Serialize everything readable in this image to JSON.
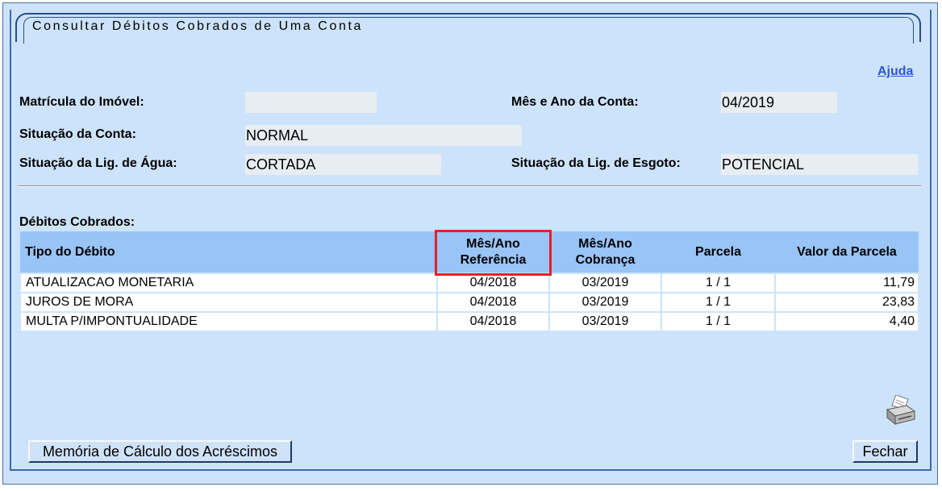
{
  "page": {
    "title": "Consultar Débitos Cobrados de Uma Conta",
    "help_label": "Ajuda"
  },
  "fields": {
    "matricula_label": "Matrícula do Imóvel:",
    "matricula_value": "",
    "mes_ano_label": "Mês e Ano da Conta:",
    "mes_ano_value": "04/2019",
    "situacao_conta_label": "Situação da Conta:",
    "situacao_conta_value": "NORMAL",
    "situacao_agua_label": "Situação da Lig. de Água:",
    "situacao_agua_value": "CORTADA",
    "situacao_esgoto_label": "Situação da Lig. de Esgoto:",
    "situacao_esgoto_value": "POTENCIAL"
  },
  "debts": {
    "section_title": "Débitos Cobrados:",
    "headers": {
      "tipo": "Tipo do Débito",
      "ref_line1": "Mês/Ano",
      "ref_line2": "Referência",
      "cob_line1": "Mês/Ano",
      "cob_line2": "Cobrança",
      "parcela": "Parcela",
      "valor": "Valor da Parcela"
    },
    "rows": [
      {
        "tipo": "ATUALIZACAO MONETARIA",
        "referencia": "04/2018",
        "cobranca": "03/2019",
        "parcela": "1 / 1",
        "valor": "11,79"
      },
      {
        "tipo": "JUROS DE MORA",
        "referencia": "04/2018",
        "cobranca": "03/2019",
        "parcela": "1 / 1",
        "valor": "23,83"
      },
      {
        "tipo": "MULTA P/IMPONTUALIDADE",
        "referencia": "04/2018",
        "cobranca": "03/2019",
        "parcela": "1 / 1",
        "valor": "4,40"
      }
    ]
  },
  "buttons": {
    "memoria_label": "Memória de Cálculo dos Acréscimos",
    "fechar_label": "Fechar"
  },
  "icons": {
    "print": "printer-icon"
  },
  "colors": {
    "background": "#cde3fb",
    "header": "#99c4f6",
    "highlight": "#e4202a",
    "link": "#2c57d6"
  }
}
